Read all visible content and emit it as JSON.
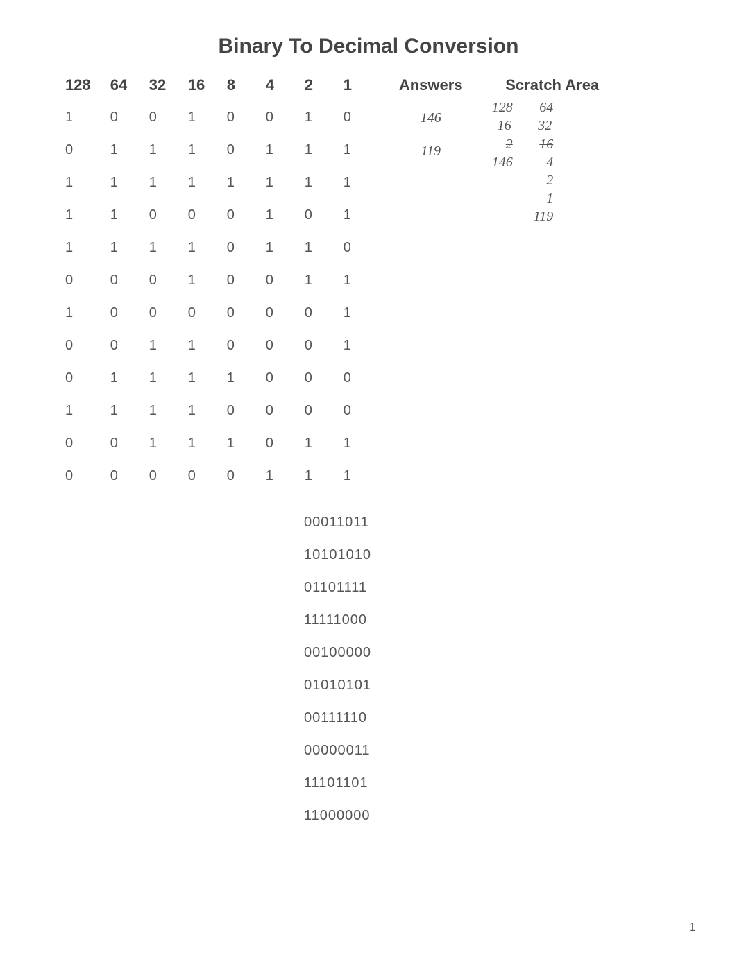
{
  "title": "Binary To Decimal Conversion",
  "headers": [
    "128",
    "64",
    "32",
    "16",
    "8",
    "4",
    "2",
    "1"
  ],
  "answers_header": "Answers",
  "scratch_header": "Scratch Area",
  "rows": [
    [
      "1",
      "0",
      "0",
      "1",
      "0",
      "0",
      "1",
      "0"
    ],
    [
      "0",
      "1",
      "1",
      "1",
      "0",
      "1",
      "1",
      "1"
    ],
    [
      "1",
      "1",
      "1",
      "1",
      "1",
      "1",
      "1",
      "1"
    ],
    [
      "1",
      "1",
      "0",
      "0",
      "0",
      "1",
      "0",
      "1"
    ],
    [
      "1",
      "1",
      "1",
      "1",
      "0",
      "1",
      "1",
      "0"
    ],
    [
      "0",
      "0",
      "0",
      "1",
      "0",
      "0",
      "1",
      "1"
    ],
    [
      "1",
      "0",
      "0",
      "0",
      "0",
      "0",
      "0",
      "1"
    ],
    [
      "0",
      "0",
      "1",
      "1",
      "0",
      "0",
      "0",
      "1"
    ],
    [
      "0",
      "1",
      "1",
      "1",
      "1",
      "0",
      "0",
      "0"
    ],
    [
      "1",
      "1",
      "1",
      "1",
      "0",
      "0",
      "0",
      "0"
    ],
    [
      "0",
      "0",
      "1",
      "1",
      "1",
      "0",
      "1",
      "1"
    ],
    [
      "0",
      "0",
      "0",
      "0",
      "0",
      "1",
      "1",
      "1"
    ]
  ],
  "answers": [
    "146",
    "119"
  ],
  "scratch": {
    "left": [
      "128",
      "16",
      "2",
      "146"
    ],
    "right": [
      "64",
      "32",
      "16",
      "4",
      "2",
      "1",
      "119"
    ]
  },
  "lower_binaries": [
    "00011011",
    "10101010",
    "01101111",
    "11111000",
    "00100000",
    "01010101",
    "00111110",
    "00000011",
    "11101101",
    "11000000"
  ],
  "page_number": "1"
}
